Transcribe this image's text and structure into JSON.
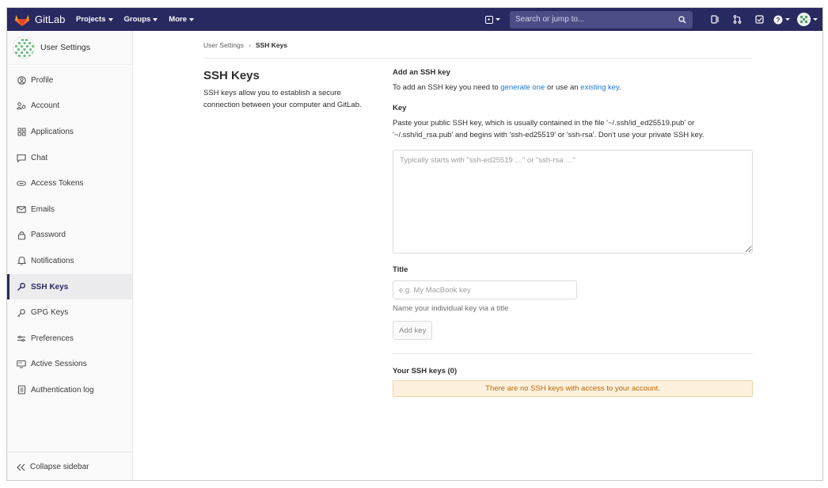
{
  "navbar": {
    "brand": "GitLab",
    "links": [
      {
        "label": "Projects"
      },
      {
        "label": "Groups"
      },
      {
        "label": "More"
      }
    ],
    "search_placeholder": "Search or jump to...",
    "bg_color": "#292961"
  },
  "sidebar": {
    "title": "User Settings",
    "items": [
      {
        "label": "Profile",
        "icon": "profile-icon"
      },
      {
        "label": "Account",
        "icon": "account-icon"
      },
      {
        "label": "Applications",
        "icon": "applications-icon"
      },
      {
        "label": "Chat",
        "icon": "chat-icon"
      },
      {
        "label": "Access Tokens",
        "icon": "access-tokens-icon"
      },
      {
        "label": "Emails",
        "icon": "emails-icon"
      },
      {
        "label": "Password",
        "icon": "password-icon"
      },
      {
        "label": "Notifications",
        "icon": "notifications-icon"
      },
      {
        "label": "SSH Keys",
        "icon": "ssh-keys-icon",
        "active": true
      },
      {
        "label": "GPG Keys",
        "icon": "gpg-keys-icon"
      },
      {
        "label": "Preferences",
        "icon": "preferences-icon"
      },
      {
        "label": "Active Sessions",
        "icon": "active-sessions-icon"
      },
      {
        "label": "Authentication log",
        "icon": "authentication-log-icon"
      }
    ],
    "collapse_label": "Collapse sidebar"
  },
  "breadcrumb": {
    "parent": "User Settings",
    "separator": "›",
    "current": "SSH Keys"
  },
  "intro": {
    "title": "SSH Keys",
    "description": "SSH keys allow you to establish a secure connection between your computer and GitLab."
  },
  "form": {
    "heading": "Add an SSH key",
    "intro_prefix": "To add an SSH key you need to ",
    "generate_link": "generate one",
    "intro_middle": " or use an ",
    "existing_link": "existing key",
    "intro_suffix": ".",
    "key_label": "Key",
    "key_help": "Paste your public SSH key, which is usually contained in the file '~/.ssh/id_ed25519.pub' or '~/.ssh/id_rsa.pub' and begins with 'ssh-ed25519' or 'ssh-rsa'. Don't use your private SSH key.",
    "key_placeholder": "Typically starts with \"ssh-ed25519 …\" or \"ssh-rsa …\"",
    "title_label": "Title",
    "title_placeholder": "e.g. My MacBook key",
    "title_help": "Name your individual key via a title",
    "add_button": "Add key"
  },
  "keys": {
    "heading": "Your SSH keys (0)",
    "empty_notice": "There are no SSH keys with access to your account.",
    "notice_bg": "#fdf1de",
    "notice_color": "#c26700"
  },
  "link_color": "#1f78d1"
}
